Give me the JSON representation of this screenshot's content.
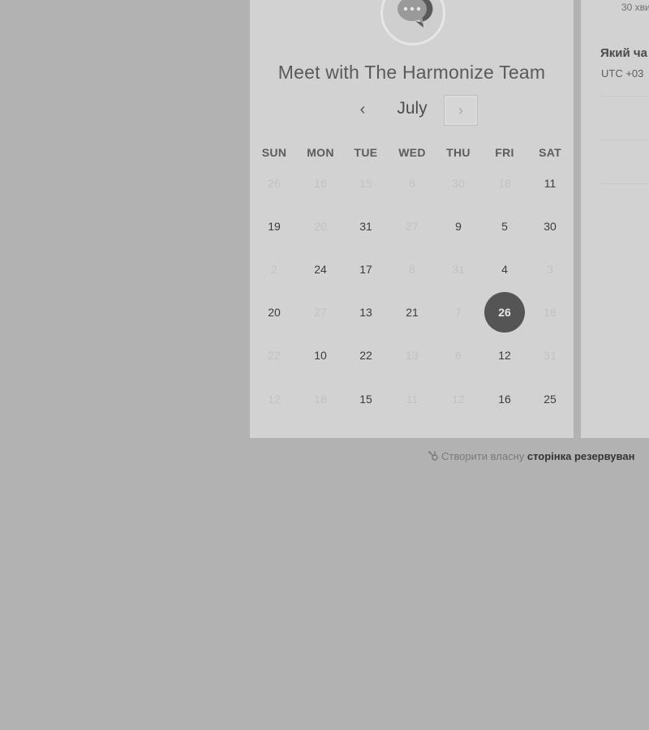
{
  "header": {
    "avatar_icon": "chat-bubble-icon",
    "title": "Meet with The Harmonize Team"
  },
  "calendar": {
    "month": "July",
    "prev_symbol": "‹",
    "next_symbol": "›",
    "weekdays": [
      "SUN",
      "MON",
      "TUE",
      "WED",
      "THU",
      "FRI",
      "SAT"
    ],
    "weeks": [
      [
        {
          "d": "26",
          "m": true
        },
        {
          "d": "16",
          "m": true
        },
        {
          "d": "15",
          "m": true
        },
        {
          "d": "6",
          "m": true
        },
        {
          "d": "30",
          "m": true
        },
        {
          "d": "18",
          "m": true
        },
        {
          "d": "11",
          "m": false
        }
      ],
      [
        {
          "d": "19",
          "m": false
        },
        {
          "d": "20",
          "m": true
        },
        {
          "d": "31",
          "m": false
        },
        {
          "d": "27",
          "m": true
        },
        {
          "d": "9",
          "m": false
        },
        {
          "d": "5",
          "m": false
        },
        {
          "d": "30",
          "m": false
        }
      ],
      [
        {
          "d": "2",
          "m": true
        },
        {
          "d": "24",
          "m": false
        },
        {
          "d": "17",
          "m": false
        },
        {
          "d": "8",
          "m": true
        },
        {
          "d": "31",
          "m": true
        },
        {
          "d": "4",
          "m": false
        },
        {
          "d": "3",
          "m": true
        }
      ],
      [
        {
          "d": "20",
          "m": false
        },
        {
          "d": "27",
          "m": true
        },
        {
          "d": "13",
          "m": false
        },
        {
          "d": "21",
          "m": false
        },
        {
          "d": "7",
          "m": true
        },
        {
          "d": "26",
          "m": false,
          "s": true
        },
        {
          "d": "18",
          "m": true
        }
      ],
      [
        {
          "d": "22",
          "m": true
        },
        {
          "d": "10",
          "m": false
        },
        {
          "d": "22",
          "m": false
        },
        {
          "d": "13",
          "m": true
        },
        {
          "d": "6",
          "m": true
        },
        {
          "d": "12",
          "m": false
        },
        {
          "d": "31",
          "m": true
        }
      ],
      [
        {
          "d": "12",
          "m": true
        },
        {
          "d": "18",
          "m": true
        },
        {
          "d": "15",
          "m": false
        },
        {
          "d": "11",
          "m": true
        },
        {
          "d": "12",
          "m": true
        },
        {
          "d": "16",
          "m": false
        },
        {
          "d": "25",
          "m": false
        }
      ]
    ]
  },
  "details": {
    "duration": "30 хви",
    "question": "Який ча",
    "timezone": "UTC +03"
  },
  "footer": {
    "icon": "sprocket-icon",
    "text": "Створити власну ",
    "brand": "сторінка резервуван"
  },
  "colors": {
    "backdrop": "#b2b2b2",
    "card": "#d2d2d2",
    "selected_day": "#555555"
  }
}
